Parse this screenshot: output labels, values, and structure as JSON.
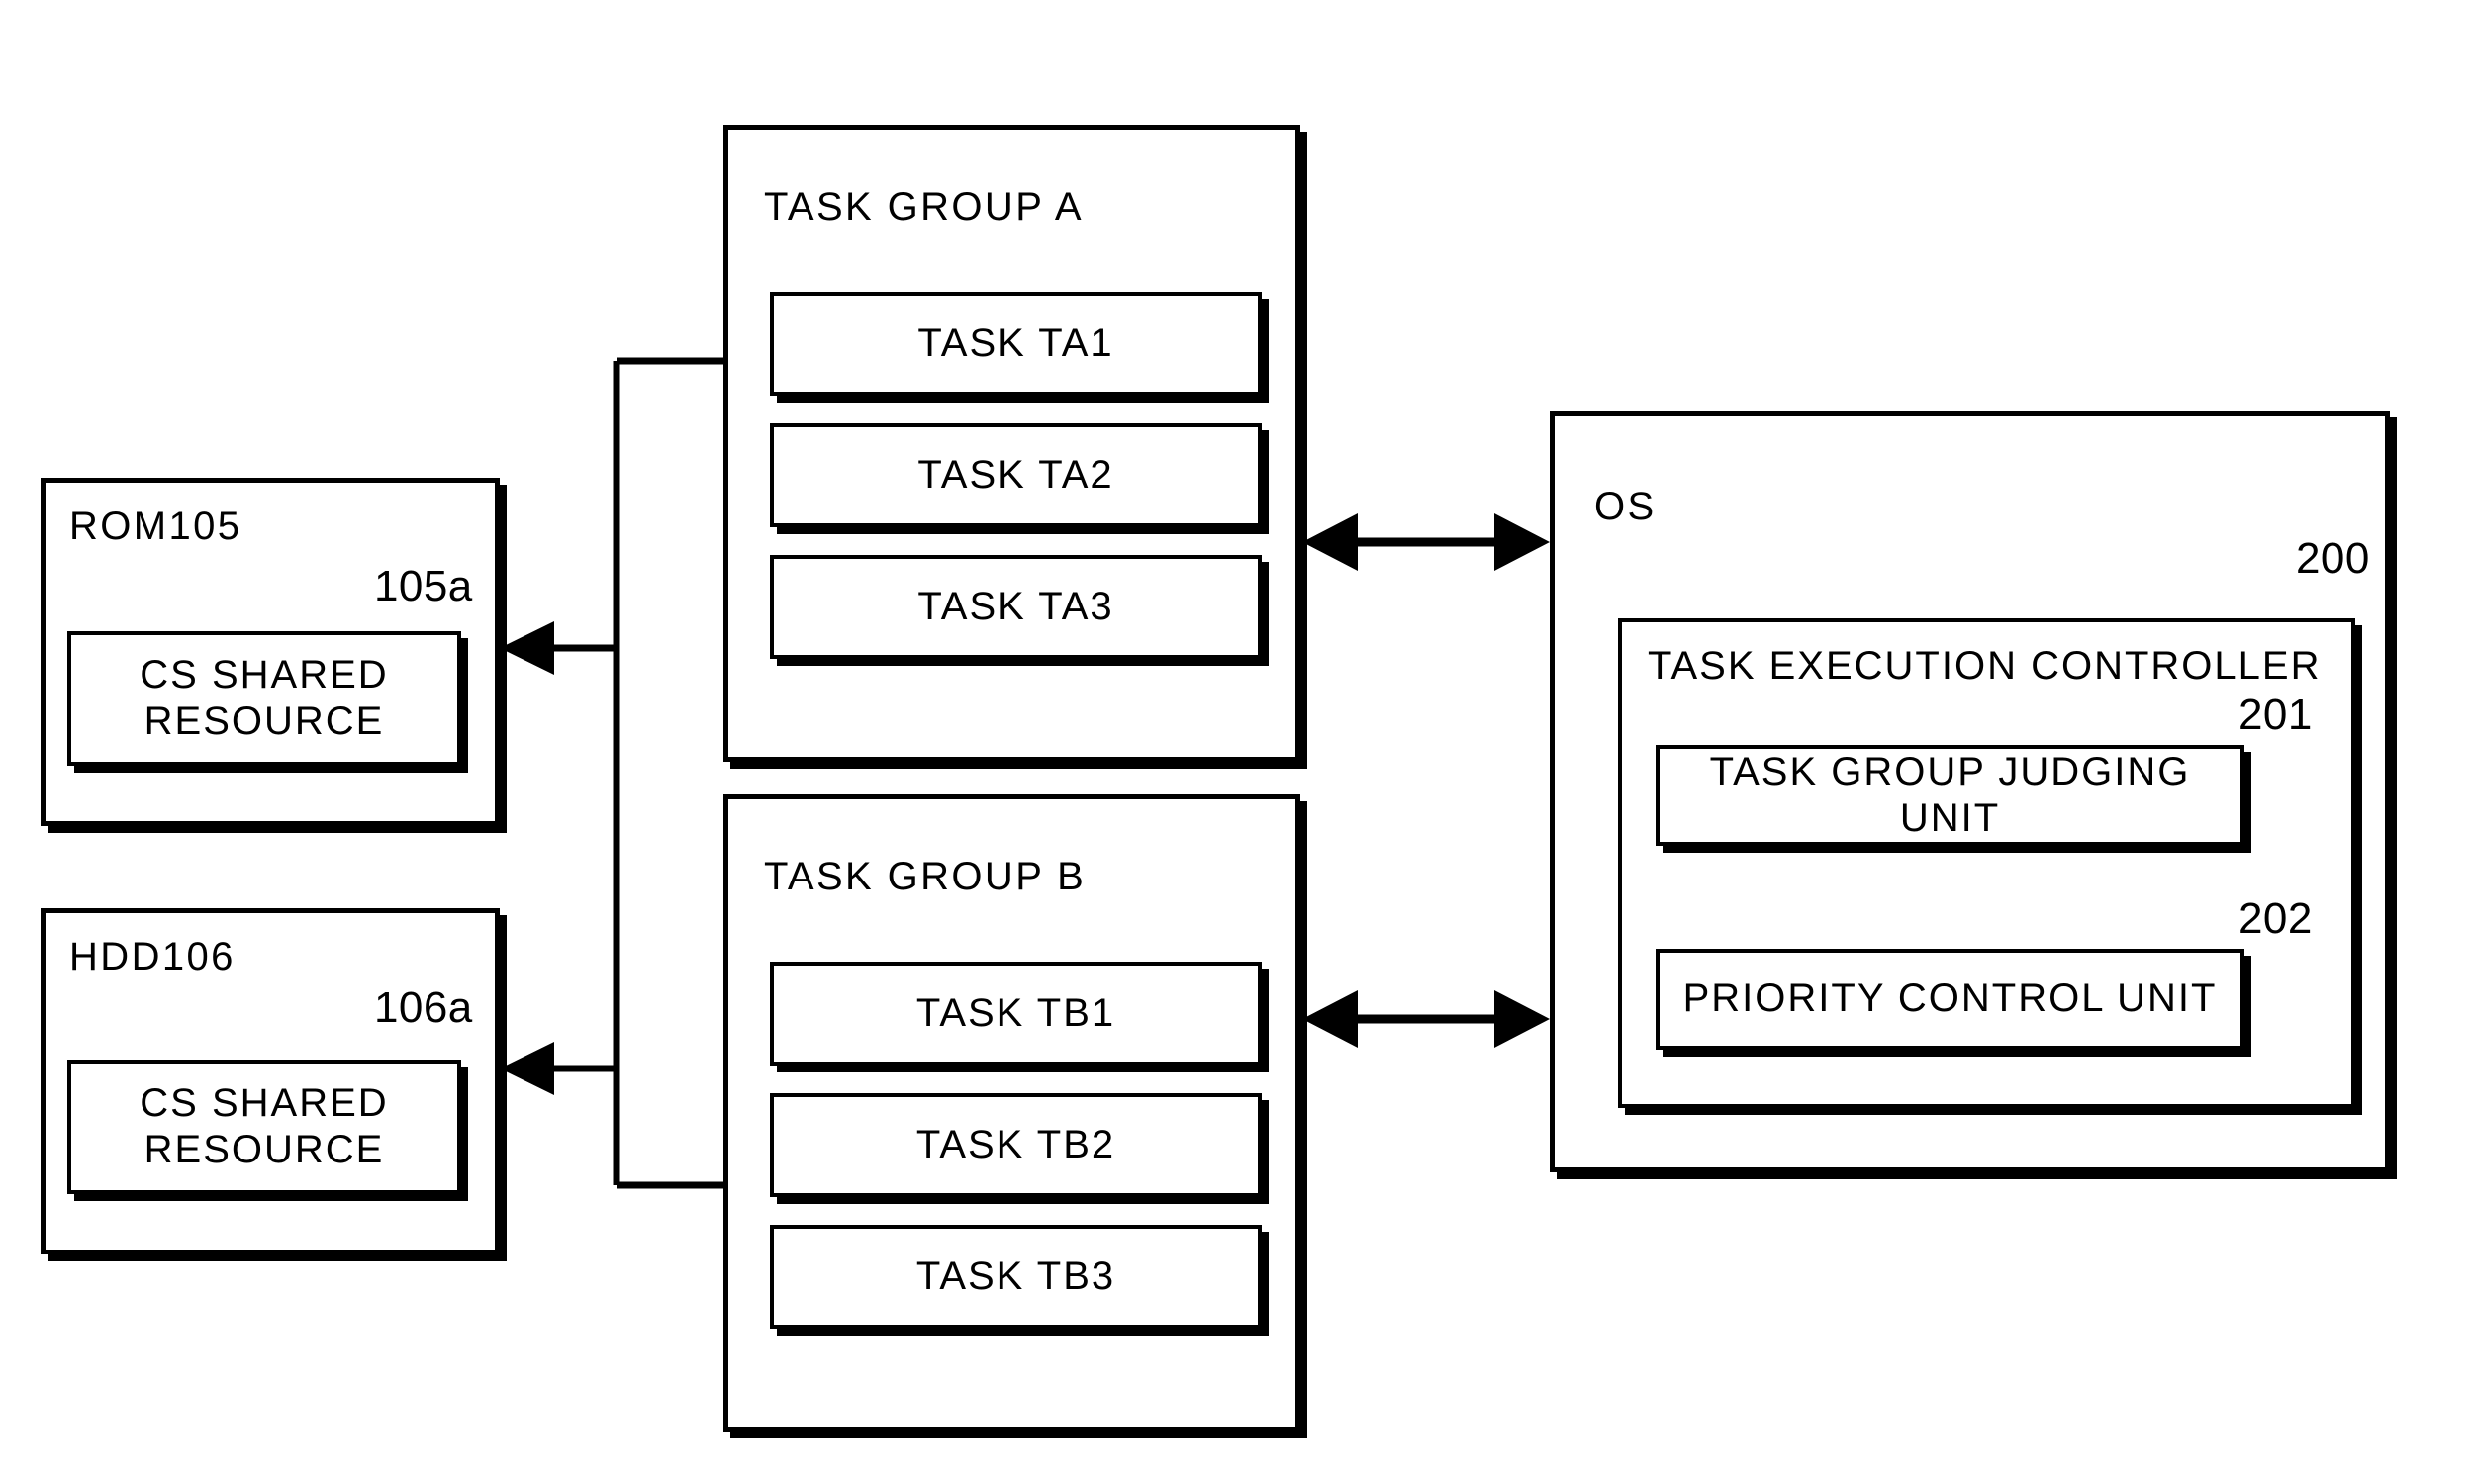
{
  "figure": {
    "type": "block-diagram",
    "blocks": {
      "rom": {
        "title": "ROM105",
        "ref": "105a",
        "inner_label_line1": "CS SHARED",
        "inner_label_line2": "RESOURCE"
      },
      "hdd": {
        "title": "HDD106",
        "ref": "106a",
        "inner_label_line1": "CS SHARED",
        "inner_label_line2": "RESOURCE"
      },
      "task_group_a": {
        "title": "TASK GROUP A",
        "tasks": [
          {
            "label": "TASK TA1"
          },
          {
            "label": "TASK TA2"
          },
          {
            "label": "TASK TA3"
          }
        ]
      },
      "task_group_b": {
        "title": "TASK GROUP B",
        "tasks": [
          {
            "label": "TASK TB1"
          },
          {
            "label": "TASK TB2"
          },
          {
            "label": "TASK TB3"
          }
        ]
      },
      "os": {
        "title": "OS",
        "controller": {
          "title": "TASK EXECUTION CONTROLLER",
          "ref": "200",
          "units": [
            {
              "label": "TASK GROUP JUDGING UNIT",
              "ref": "201"
            },
            {
              "label": "PRIORITY CONTROL UNIT",
              "ref": "202"
            }
          ]
        }
      }
    },
    "connectors": {
      "bus_to_rom": "arrow-left",
      "bus_to_hdd": "arrow-left",
      "group_a_to_os": "double-arrow",
      "group_b_to_os": "double-arrow"
    },
    "colors": {
      "line": "#000000",
      "background": "#ffffff"
    }
  }
}
